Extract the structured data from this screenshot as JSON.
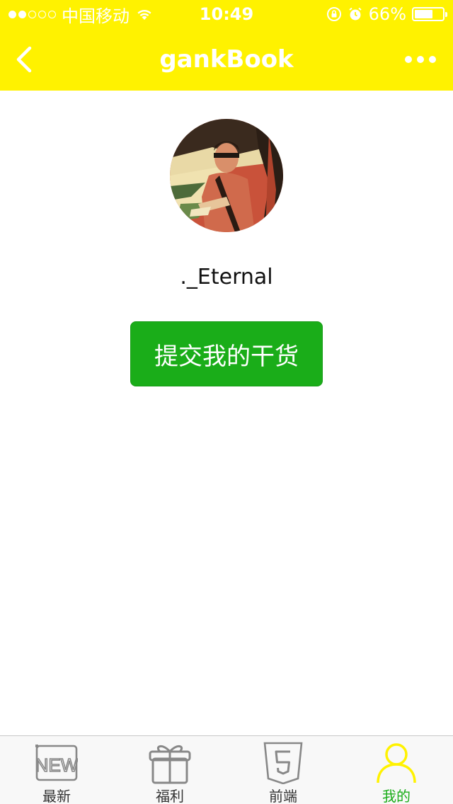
{
  "status_bar": {
    "carrier": "中国移动",
    "time": "10:49",
    "battery": "66%",
    "battery_level": 0.66
  },
  "nav": {
    "title": "gankBook"
  },
  "profile": {
    "username": "._Eternal",
    "submit_label": "提交我的干货"
  },
  "tabs": [
    {
      "label": "最新",
      "icon": "new-icon"
    },
    {
      "label": "福利",
      "icon": "gift-icon"
    },
    {
      "label": "前端",
      "icon": "html5-icon"
    },
    {
      "label": "我的",
      "icon": "user-icon"
    }
  ],
  "colors": {
    "header": "#FFF200",
    "primary_button": "#1AAD19",
    "active_tab": "#FFF200",
    "active_tab_label": "#1AAD19",
    "inactive_tab": "#888888"
  }
}
